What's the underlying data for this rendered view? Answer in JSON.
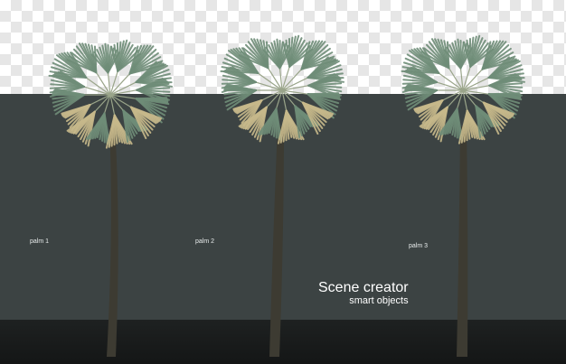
{
  "labels": {
    "palm1": "palm 1",
    "palm2": "palm 2",
    "palm3": "palm 3"
  },
  "caption": {
    "title": "Scene creator",
    "subtitle": "smart objects"
  },
  "colors": {
    "backdrop": "#3c4343",
    "floor": "#161818",
    "checker": "#e6e6e6",
    "trunk": "#3d3b32",
    "frond_green": "#6f8d78",
    "frond_dry": "#c7b98b",
    "text": "#ffffff"
  }
}
